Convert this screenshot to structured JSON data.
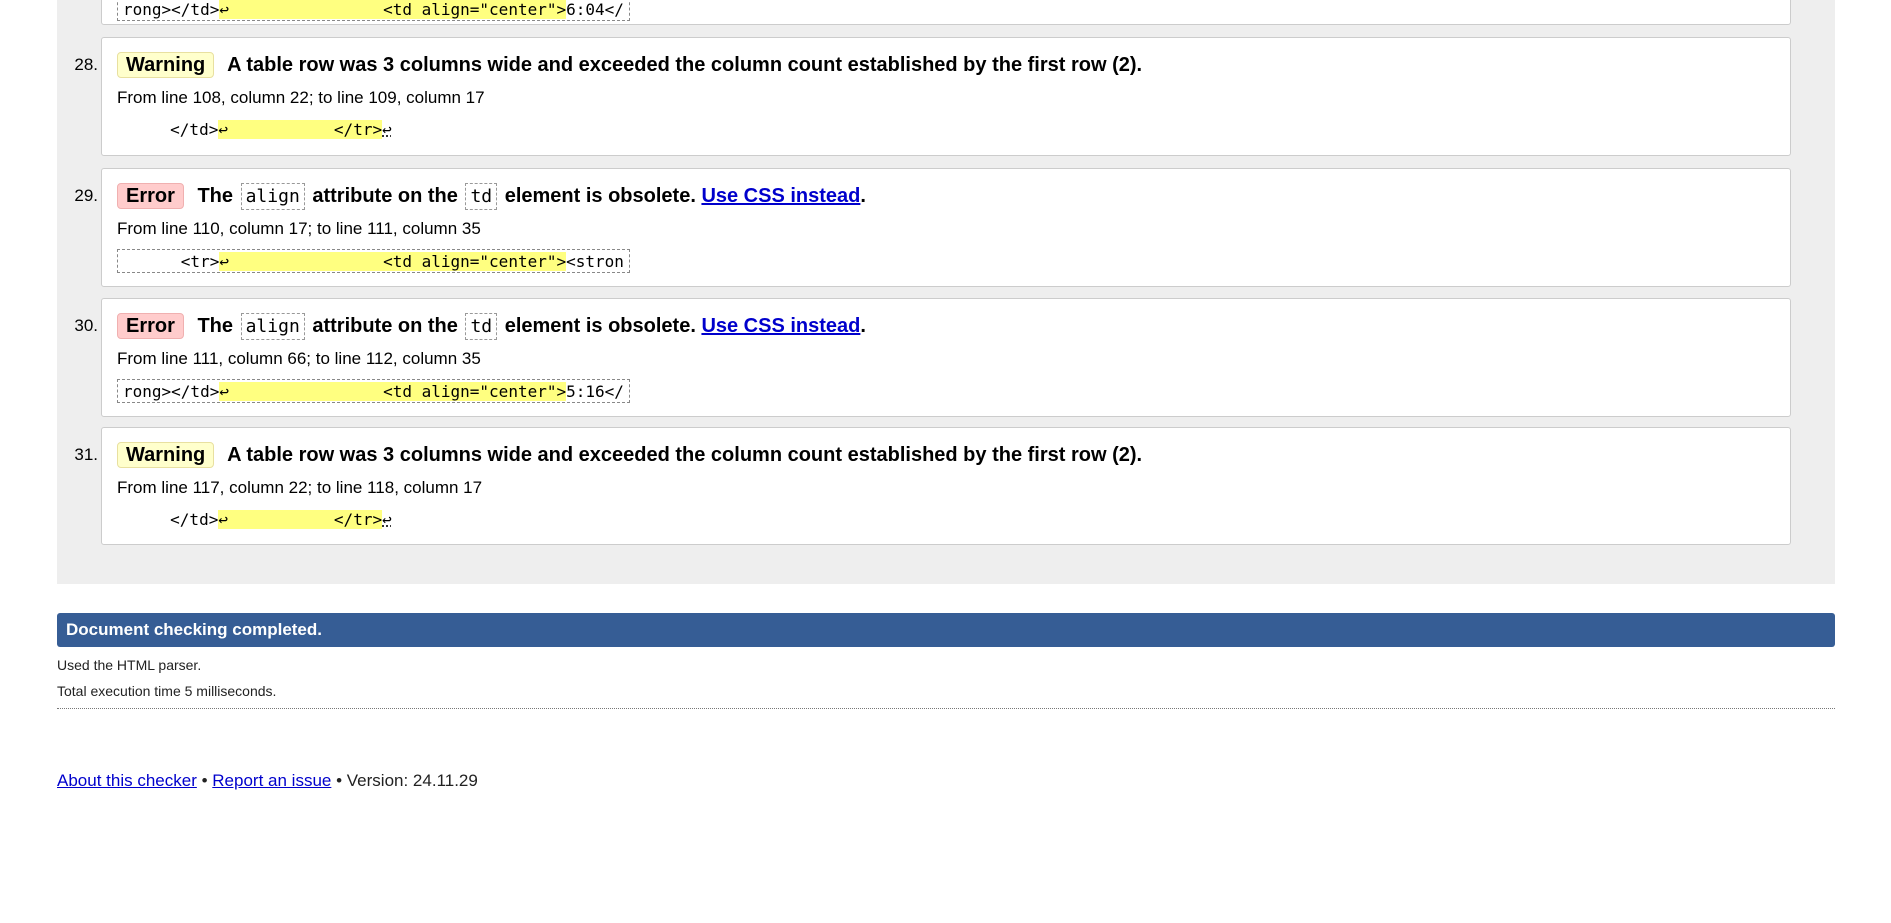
{
  "prev_tail": {
    "extract_pre": "rong></td>",
    "extract_hl": "↩                <td align=\"center\">",
    "extract_post": "6:04</"
  },
  "messages": [
    {
      "num": "28.",
      "type": "Warning",
      "text": "A table row was 3 columns wide and exceeded the column count established by the first row (2).",
      "location": "From line 108, column 22; to line 109, column 17",
      "extract_pre": "     </td>",
      "extract_hl": "↩           </tr>",
      "extract_post": "↩"
    },
    {
      "num": "29.",
      "type": "Error",
      "text_a": "The",
      "code_1": "align",
      "text_b": "attribute on the",
      "code_2": "td",
      "text_c": "element is obsolete.",
      "link": "Use CSS instead",
      "tail": ".",
      "location": "From line 110, column 17; to line 111, column 35",
      "extract_pre": "      <tr>",
      "extract_hl": "↩                <td align=\"center\">",
      "extract_post": "<stron"
    },
    {
      "num": "30.",
      "type": "Error",
      "text_a": "The",
      "code_1": "align",
      "text_b": "attribute on the",
      "code_2": "td",
      "text_c": "element is obsolete.",
      "link": "Use CSS instead",
      "tail": ".",
      "location": "From line 111, column 66; to line 112, column 35",
      "extract_pre": "rong></td>",
      "extract_hl": "↩                <td align=\"center\">",
      "extract_post": "5:16</"
    },
    {
      "num": "31.",
      "type": "Warning",
      "text": "A table row was 3 columns wide and exceeded the column count established by the first row (2).",
      "location": "From line 117, column 22; to line 118, column 17",
      "extract_pre": "     </td>",
      "extract_hl": "↩           </tr>",
      "extract_post": "↩"
    }
  ],
  "completed": {
    "heading": "Document checking completed.",
    "parser": "Used the HTML parser.",
    "time": "Total execution time 5 milliseconds."
  },
  "footer": {
    "about": "About this checker",
    "sep1": "•",
    "report": "Report an issue",
    "sep2": "•",
    "version": "Version: 24.11.29"
  },
  "colors": {
    "warning_bg": "#ffffcc",
    "error_bg": "#ffcccc",
    "highlight": "#ffff80",
    "banner": "#365d95",
    "link": "#0000cc"
  }
}
